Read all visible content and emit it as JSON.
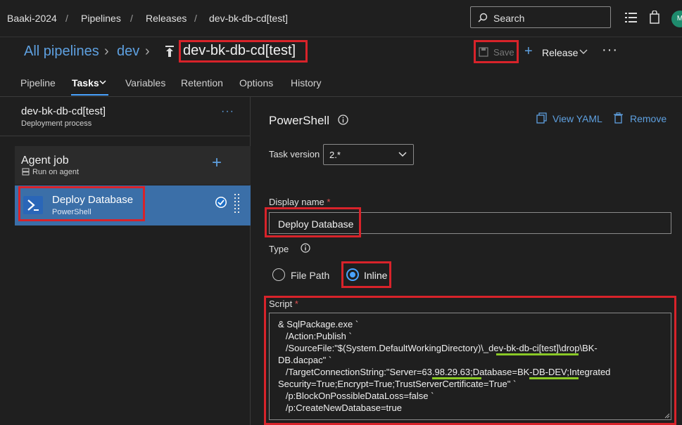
{
  "topbar": {
    "org": "Baaki-2024",
    "pipelines": "Pipelines",
    "releases": "Releases",
    "pipeline": "dev-bk-db-cd[test]",
    "search_label": "Search",
    "avatar": "M"
  },
  "header": {
    "all_pipelines": "All pipelines",
    "folder": "dev",
    "title": "dev-bk-db-cd[test]",
    "save": "Save",
    "release": "Release"
  },
  "tabs": [
    "Pipeline",
    "Tasks",
    "Variables",
    "Retention",
    "Options",
    "History"
  ],
  "left": {
    "title": "dev-bk-db-cd[test]",
    "subtitle": "Deployment process",
    "agent_job": "Agent job",
    "agent_sub": "Run on agent",
    "task_title": "Deploy Database",
    "task_sub": "PowerShell"
  },
  "right": {
    "title": "PowerShell",
    "view_yaml": "View YAML",
    "remove": "Remove",
    "task_version_label": "Task version",
    "task_version": "2.*",
    "display_name_label": "Display name",
    "display_name": "Deploy Database",
    "type_label": "Type",
    "file_path": "File Path",
    "inline": "Inline",
    "script_label": "Script",
    "script_lines": [
      "& SqlPackage.exe `",
      "   /Action:Publish `",
      "   /SourceFile:\"$(System.DefaultWorkingDirectory)\\_dev-bk-db-ci[test]\\drop\\BK-",
      "DB.dacpac\" `",
      "   /TargetConnectionString:\"Server=63.98.29.63;Database=BK-DB-DEV;Integrated",
      "Security=True;Encrypt=True;TrustServerCertificate=True\" `",
      "   /p:BlockOnPossibleDataLoss=false `",
      "   /p:CreateNewDatabase=true"
    ]
  },
  "colors": {
    "accent": "#4aa3ff",
    "highlight": "#d8232a",
    "underline": "#8ac926",
    "selected_row": "#3b6fa8"
  }
}
